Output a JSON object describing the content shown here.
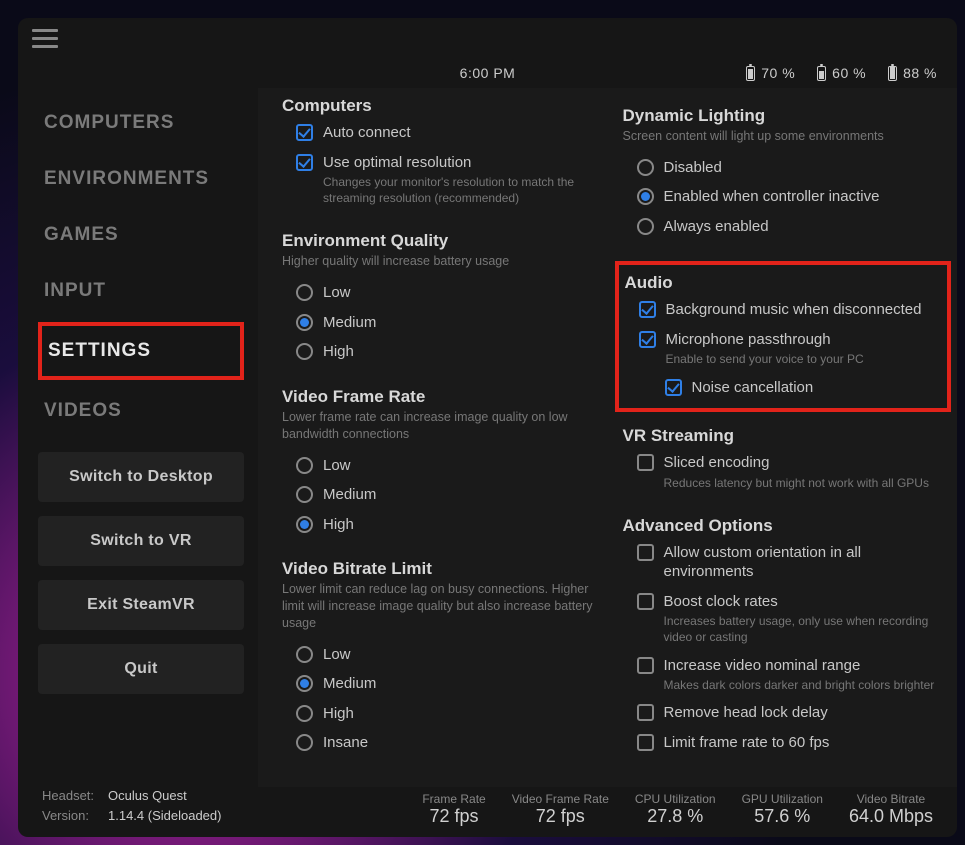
{
  "statusbar": {
    "clock": "6:00 PM",
    "batteries": [
      {
        "percent": "70 %",
        "level": "70%"
      },
      {
        "percent": "60 %",
        "level": "60%"
      },
      {
        "percent": "88 %",
        "level": "88%"
      }
    ]
  },
  "sidebar": {
    "items": [
      {
        "label": "COMPUTERS",
        "active": false
      },
      {
        "label": "ENVIRONMENTS",
        "active": false
      },
      {
        "label": "GAMES",
        "active": false
      },
      {
        "label": "INPUT",
        "active": false
      },
      {
        "label": "SETTINGS",
        "active": true,
        "highlighted": true
      },
      {
        "label": "VIDEOS",
        "active": false
      }
    ],
    "buttons": {
      "switch_desktop": "Switch to Desktop",
      "switch_vr": "Switch to VR",
      "exit_steamvr": "Exit SteamVR",
      "quit": "Quit"
    }
  },
  "settings": {
    "computers": {
      "title": "Computers",
      "auto_connect": {
        "label": "Auto connect",
        "checked": true
      },
      "optimal_res": {
        "label": "Use optimal resolution",
        "checked": true,
        "desc": "Changes your monitor's resolution to match the streaming resolution (recommended)"
      }
    },
    "env_quality": {
      "title": "Environment Quality",
      "sub": "Higher quality will increase battery usage",
      "options": [
        "Low",
        "Medium",
        "High"
      ],
      "selected": "Medium"
    },
    "frame_rate": {
      "title": "Video Frame Rate",
      "sub": "Lower frame rate can increase image quality on low bandwidth connections",
      "options": [
        "Low",
        "Medium",
        "High"
      ],
      "selected": "High"
    },
    "bitrate": {
      "title": "Video Bitrate Limit",
      "sub": "Lower limit can reduce lag on busy connections. Higher limit will increase image quality but also increase battery usage",
      "options": [
        "Low",
        "Medium",
        "High",
        "Insane"
      ],
      "selected": "Medium"
    },
    "lighting": {
      "title": "Dynamic Lighting",
      "sub": "Screen content will light up some environments",
      "options": [
        "Disabled",
        "Enabled when controller inactive",
        "Always enabled"
      ],
      "selected": "Enabled when controller inactive"
    },
    "audio": {
      "title": "Audio",
      "bg_music": {
        "label": "Background music when disconnected",
        "checked": true
      },
      "mic": {
        "label": "Microphone passthrough",
        "checked": true,
        "desc": "Enable to send your voice to your PC"
      },
      "noise": {
        "label": "Noise cancellation",
        "checked": true
      }
    },
    "vr_streaming": {
      "title": "VR Streaming",
      "sliced": {
        "label": "Sliced encoding",
        "checked": false,
        "desc": "Reduces latency but might not work with all GPUs"
      }
    },
    "advanced": {
      "title": "Advanced Options",
      "orient": {
        "label": "Allow custom orientation in all environments",
        "checked": false
      },
      "boost": {
        "label": "Boost clock rates",
        "checked": false,
        "desc": "Increases battery usage, only use when recording video or casting"
      },
      "nominal": {
        "label": "Increase video nominal range",
        "checked": false,
        "desc": "Makes dark colors darker and bright colors brighter"
      },
      "headlock": {
        "label": "Remove head lock delay",
        "checked": false
      },
      "limit60": {
        "label": "Limit frame rate to 60 fps",
        "checked": false
      }
    }
  },
  "stats": {
    "frame_rate": {
      "label": "Frame Rate",
      "value": "72 fps"
    },
    "video_frame_rate": {
      "label": "Video Frame Rate",
      "value": "72 fps"
    },
    "cpu": {
      "label": "CPU Utilization",
      "value": "27.8 %"
    },
    "gpu": {
      "label": "GPU Utilization",
      "value": "57.6 %"
    },
    "bitrate": {
      "label": "Video Bitrate",
      "value": "64.0 Mbps"
    }
  },
  "footer": {
    "headset_label": "Headset:",
    "headset_value": "Oculus Quest",
    "version_label": "Version:",
    "version_value": "1.14.4 (Sideloaded)"
  }
}
